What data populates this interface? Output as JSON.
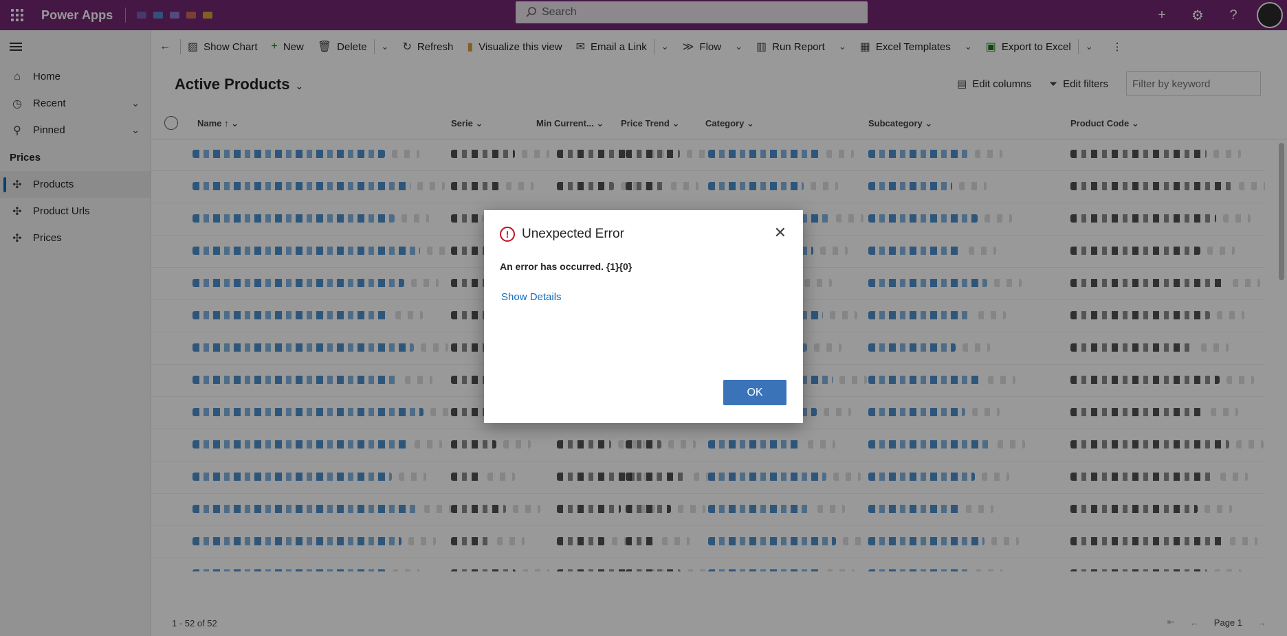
{
  "topbar": {
    "app_name": "Power Apps",
    "search_placeholder": "Search",
    "env_icon_colors": [
      "#7a5fb3",
      "#5b86c9",
      "#8e7bd1",
      "#c96b5b",
      "#d9a13a"
    ]
  },
  "nav": {
    "items": [
      {
        "label": "Home",
        "icon": "home-icon"
      },
      {
        "label": "Recent",
        "icon": "clock-icon"
      },
      {
        "label": "Pinned",
        "icon": "pin-icon"
      }
    ],
    "group_label": "Prices",
    "group_items": [
      {
        "label": "Products",
        "icon": "puzzle-icon",
        "selected": true
      },
      {
        "label": "Product Urls",
        "icon": "puzzle-icon"
      },
      {
        "label": "Prices",
        "icon": "puzzle-icon"
      }
    ]
  },
  "commands": {
    "show_chart": "Show Chart",
    "new": "New",
    "delete": "Delete",
    "refresh": "Refresh",
    "visualize": "Visualize this view",
    "email_link": "Email a Link",
    "flow": "Flow",
    "run_report": "Run Report",
    "excel_templates": "Excel Templates",
    "export_excel": "Export to Excel"
  },
  "view": {
    "title": "Active Products",
    "edit_columns": "Edit columns",
    "edit_filters": "Edit filters",
    "filter_placeholder": "Filter by keyword"
  },
  "grid": {
    "columns": [
      "Name",
      "Serie",
      "Min Current...",
      "Price Trend",
      "Category",
      "Subcategory",
      "Product Code"
    ],
    "row_count": 14
  },
  "footer": {
    "record_count": "1 - 52 of 52",
    "page_label": "Page 1"
  },
  "dialog": {
    "title": "Unexpected Error",
    "message": "An error has occurred. {1}{0}",
    "show_details": "Show Details",
    "ok_label": "OK",
    "accent": "#c50f1f"
  }
}
